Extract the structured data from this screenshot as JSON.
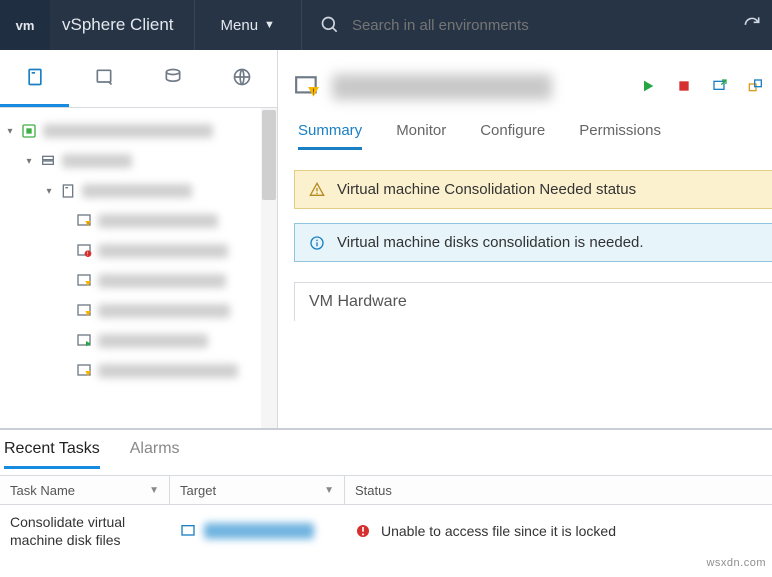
{
  "header": {
    "logo": "vm",
    "title": "vSphere Client",
    "menu_label": "Menu",
    "search_placeholder": "Search in all environments"
  },
  "main": {
    "tabs": [
      "Summary",
      "Monitor",
      "Configure",
      "Permissions"
    ],
    "active_tab": 0,
    "alerts": {
      "warn": "Virtual machine Consolidation Needed status",
      "info": "Virtual machine disks consolidation is needed."
    },
    "panel_title": "VM Hardware"
  },
  "bottom": {
    "tabs": [
      "Recent Tasks",
      "Alarms"
    ],
    "active_tab": 0,
    "columns": [
      "Task Name",
      "Target",
      "Status"
    ],
    "row": {
      "task_name": "Consolidate virtual machine disk files",
      "status": "Unable to access file since it is locked"
    }
  },
  "watermark": "wsxdn.com"
}
